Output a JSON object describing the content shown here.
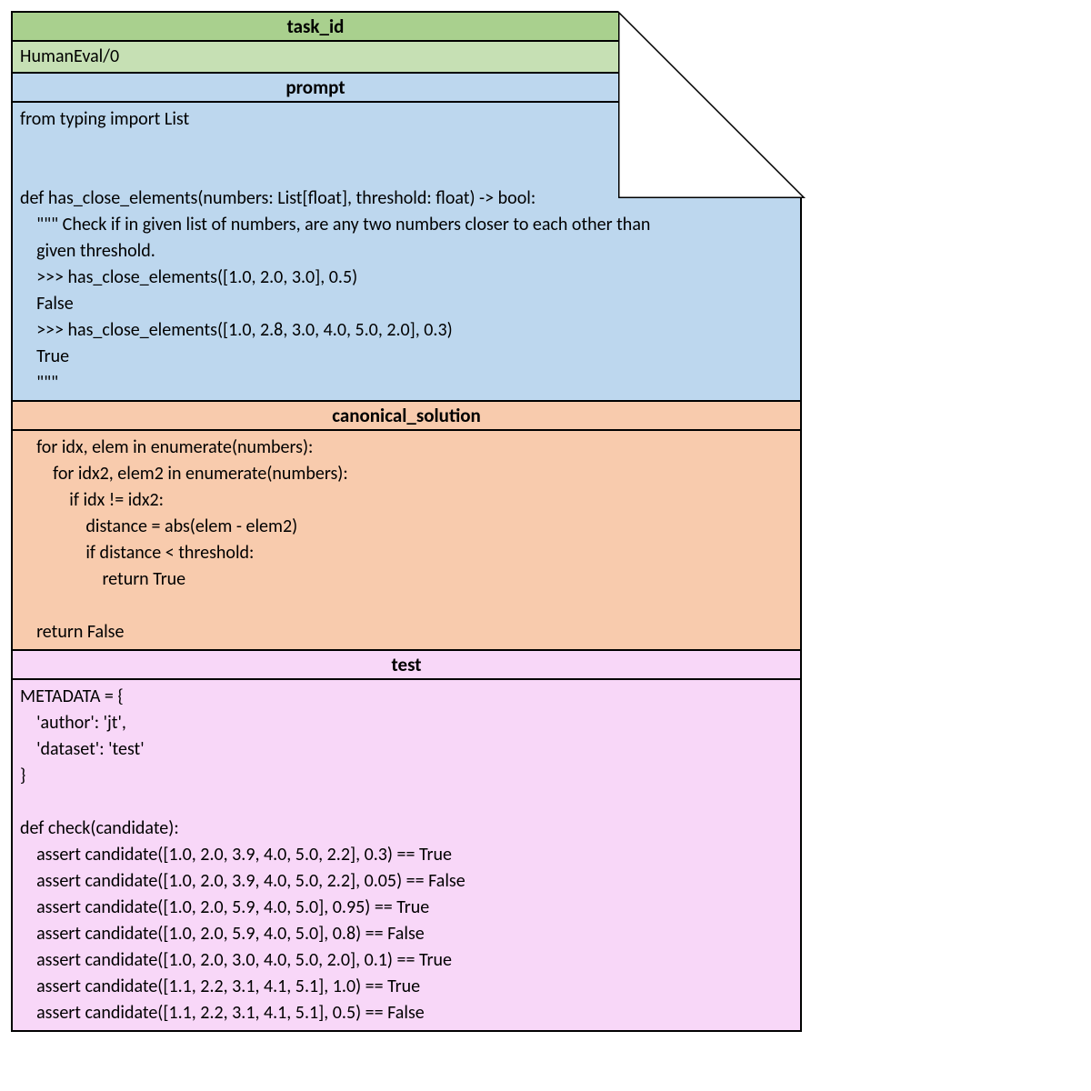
{
  "task_id": {
    "header": "task_id",
    "value": "HumanEval/0"
  },
  "prompt": {
    "header": "prompt",
    "code": "from typing import List\n\n\ndef has_close_elements(numbers: List[float], threshold: float) -> bool:\n    \"\"\" Check if in given list of numbers, are any two numbers closer to each other than\n    given threshold.\n    >>> has_close_elements([1.0, 2.0, 3.0], 0.5)\n    False\n    >>> has_close_elements([1.0, 2.8, 3.0, 4.0, 5.0, 2.0], 0.3)\n    True\n    \"\"\""
  },
  "canonical_solution": {
    "header": "canonical_solution",
    "code": "    for idx, elem in enumerate(numbers):\n        for idx2, elem2 in enumerate(numbers):\n            if idx != idx2:\n                distance = abs(elem - elem2)\n                if distance < threshold:\n                    return True\n\n    return False"
  },
  "test": {
    "header": "test",
    "code": "METADATA = {\n    'author': 'jt',\n    'dataset': 'test'\n}\n\ndef check(candidate):\n    assert candidate([1.0, 2.0, 3.9, 4.0, 5.0, 2.2], 0.3) == True\n    assert candidate([1.0, 2.0, 3.9, 4.0, 5.0, 2.2], 0.05) == False\n    assert candidate([1.0, 2.0, 5.9, 4.0, 5.0], 0.95) == True\n    assert candidate([1.0, 2.0, 5.9, 4.0, 5.0], 0.8) == False\n    assert candidate([1.0, 2.0, 3.0, 4.0, 5.0, 2.0], 0.1) == True\n    assert candidate([1.1, 2.2, 3.1, 4.1, 5.1], 1.0) == True\n    assert candidate([1.1, 2.2, 3.1, 4.1, 5.1], 0.5) == False"
  },
  "colors": {
    "task_id": "#c6e0b4",
    "prompt": "#bdd7ee",
    "canonical_solution": "#f8cbad",
    "test": "#f8d7f8"
  }
}
